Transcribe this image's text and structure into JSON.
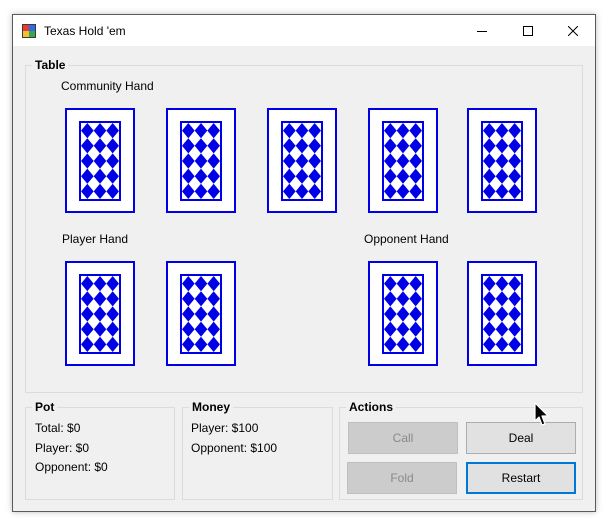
{
  "window": {
    "title": "Texas Hold 'em"
  },
  "table": {
    "title": "Table",
    "community_label": "Community Hand",
    "player_label": "Player Hand",
    "opponent_label": "Opponent Hand",
    "card_back_color": "#0000e6",
    "community_cards": [
      "card-back",
      "card-back",
      "card-back",
      "card-back",
      "card-back"
    ],
    "player_cards": [
      "card-back",
      "card-back"
    ],
    "opponent_cards": [
      "card-back",
      "card-back"
    ]
  },
  "pot": {
    "title": "Pot",
    "total": "Total: $0",
    "player": "Player: $0",
    "opponent": "Opponent: $0"
  },
  "money": {
    "title": "Money",
    "player": "Player: $100",
    "opponent": "Opponent: $100"
  },
  "actions": {
    "title": "Actions",
    "call_label": "Call",
    "deal_label": "Deal",
    "fold_label": "Fold",
    "restart_label": "Restart",
    "call_enabled": false,
    "fold_enabled": false
  }
}
